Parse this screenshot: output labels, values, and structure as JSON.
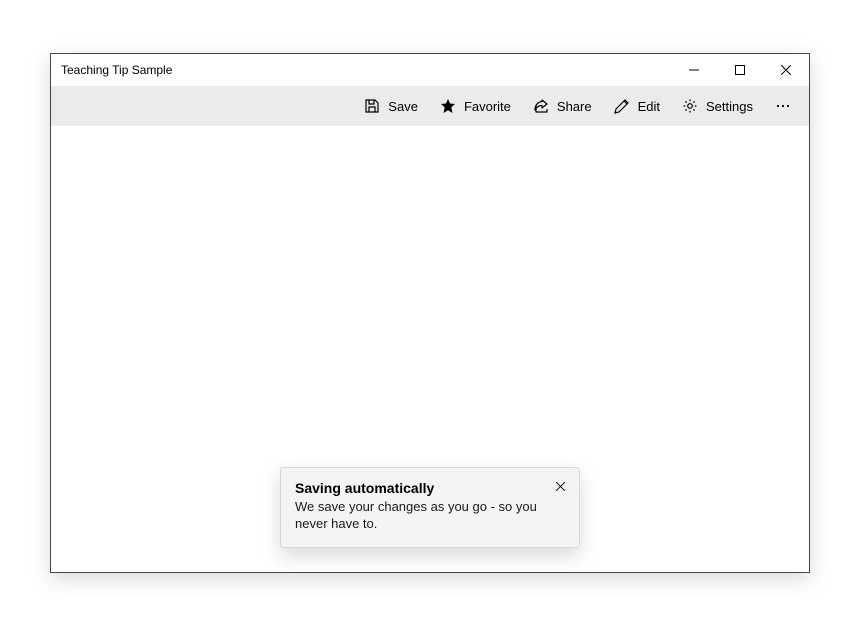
{
  "window": {
    "title": "Teaching Tip Sample"
  },
  "toolbar": {
    "save_label": "Save",
    "favorite_label": "Favorite",
    "share_label": "Share",
    "edit_label": "Edit",
    "settings_label": "Settings"
  },
  "tip": {
    "title": "Saving automatically",
    "body": "We save your changes as you go - so you never have to."
  }
}
